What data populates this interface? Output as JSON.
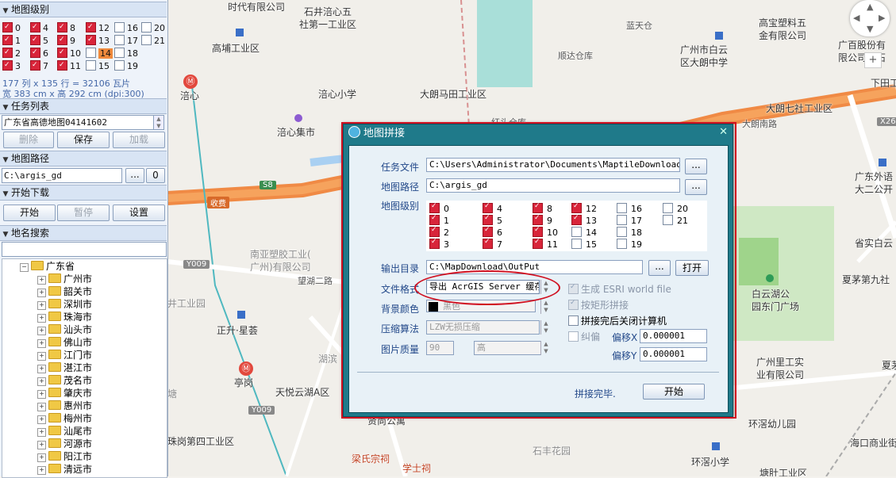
{
  "left_panel": {
    "sections": {
      "map_level": "地图级别",
      "task_list": "任务列表",
      "map_path": "地图路径",
      "start_download": "开始下载",
      "place_search": "地名搜索"
    },
    "levels": [
      {
        "n": "0",
        "on": true
      },
      {
        "n": "4",
        "on": true
      },
      {
        "n": "8",
        "on": true
      },
      {
        "n": "12",
        "on": true
      },
      {
        "n": "16",
        "on": false
      },
      {
        "n": "20",
        "on": false
      },
      {
        "n": "1",
        "on": true
      },
      {
        "n": "5",
        "on": true
      },
      {
        "n": "9",
        "on": true
      },
      {
        "n": "13",
        "on": true
      },
      {
        "n": "17",
        "on": false
      },
      {
        "n": "21",
        "on": false
      },
      {
        "n": "2",
        "on": true
      },
      {
        "n": "6",
        "on": true
      },
      {
        "n": "10",
        "on": true
      },
      {
        "n": "14",
        "on": false,
        "hl": true
      },
      {
        "n": "18",
        "on": false
      },
      {
        "n": "3",
        "on": true
      },
      {
        "n": "7",
        "on": true
      },
      {
        "n": "11",
        "on": true
      },
      {
        "n": "15",
        "on": false
      },
      {
        "n": "19",
        "on": false
      }
    ],
    "tile_info": "177 列 x 135 行 = 32106 瓦片",
    "size_info": "宽 383 cm x 高 292 cm (dpi:300)",
    "task_value": "广东省高德地图04141602",
    "task_buttons": {
      "delete": "删除",
      "save": "保存",
      "load": "加载"
    },
    "path_value": "C:\\argis_gd",
    "path_browse": "...",
    "path_zero": "0",
    "download_buttons": {
      "start": "开始",
      "pause": "暂停",
      "settings": "设置"
    },
    "search_value": "",
    "tree_root": "广东省",
    "tree_items": [
      "广州市",
      "韶关市",
      "深圳市",
      "珠海市",
      "汕头市",
      "佛山市",
      "江门市",
      "湛江市",
      "茂名市",
      "肇庆市",
      "惠州市",
      "梅州市",
      "汕尾市",
      "河源市",
      "阳江市",
      "清远市"
    ]
  },
  "dialog": {
    "title": "地图拼接",
    "close": "✕",
    "labels": {
      "task_file": "任务文件",
      "map_path": "地图路径",
      "map_level": "地图级别",
      "output_dir": "输出目录",
      "file_format": "文件格式",
      "bg_color": "背景颜色",
      "compression": "压缩算法",
      "image_quality": "图片质量",
      "offset_x": "偏移X",
      "offset_y": "偏移Y"
    },
    "task_file_value": "C:\\Users\\Administrator\\Documents\\MaptileDownloader\\Pr",
    "map_path_value": "C:\\argis_gd",
    "output_dir_value": "C:\\MapDownload\\OutPut",
    "browse": "...",
    "open_button": "打开",
    "file_format_value": "导出 AcrGIS Server 缓存",
    "bg_color_value": "黑色",
    "compression_value": "LZW无损压缩",
    "quality_value": "90",
    "quality_level": "高",
    "options": {
      "esri_world_file": "生成 ESRI world file",
      "rect_merge": "按矩形拼接",
      "shutdown": "拼接完后关闭计算机",
      "correction": "纠偏"
    },
    "offset_x_value": "0.000001",
    "offset_y_value": "0.000001",
    "status": "拼接完毕.",
    "start_button": "开始",
    "levels": [
      {
        "n": "0",
        "on": true
      },
      {
        "n": "4",
        "on": true
      },
      {
        "n": "8",
        "on": true
      },
      {
        "n": "12",
        "on": true
      },
      {
        "n": "16",
        "on": false
      },
      {
        "n": "20",
        "on": false
      },
      {
        "n": "1",
        "on": true
      },
      {
        "n": "5",
        "on": true
      },
      {
        "n": "9",
        "on": true
      },
      {
        "n": "13",
        "on": true
      },
      {
        "n": "17",
        "on": false
      },
      {
        "n": "21",
        "on": false
      },
      {
        "n": "2",
        "on": true
      },
      {
        "n": "6",
        "on": true
      },
      {
        "n": "10",
        "on": true
      },
      {
        "n": "14",
        "on": false
      },
      {
        "n": "18",
        "on": false
      },
      {
        "n": "3",
        "on": true
      },
      {
        "n": "7",
        "on": true
      },
      {
        "n": "11",
        "on": true
      },
      {
        "n": "15",
        "on": false
      },
      {
        "n": "19",
        "on": false
      }
    ]
  },
  "map": {
    "labels": [
      "时代有限公司",
      "石井涪心五",
      "社第一工业区",
      "蓝天仓",
      "高宝塑料五",
      "金有限公司",
      "广百股份有",
      "限公司大石",
      "高埔工业区",
      "广州市白云",
      "区大朗中学",
      "顺达仓库",
      "下田工",
      "大朗马田工业区",
      "大朗七社工业区",
      "涪心",
      "涪心小学",
      "红头仓库",
      "大朗南路",
      "涪心集市",
      "广东外语",
      "大二公开",
      "S8",
      "收费",
      "X26",
      "南亚塑胶工业(",
      "广州)有限公司",
      "望湖二路",
      "Y009",
      "省实白云",
      "夏茅第九社",
      "白云湖公",
      "园东门广场",
      "井工业园",
      "正升·星荟",
      "广州里工实",
      "业有限公司",
      "湖滨",
      "亭岗",
      "天悦云湖A区",
      "Y009",
      "夏茅",
      "环滘幼儿园",
      "贤尚公寓",
      "珠岗第四工业区",
      "梁氏宗祠",
      "学士祠",
      "石丰花园",
      "环滘小学",
      "海口商业街",
      "塘肚工业区",
      "塘"
    ],
    "nav_n": "N",
    "zoom_plus": "+"
  },
  "colors": {
    "dialog_frame": "#1f7a8a",
    "highlight": "#d01020",
    "checked": "#d8253a",
    "highlight_level": "#f08a3c"
  }
}
